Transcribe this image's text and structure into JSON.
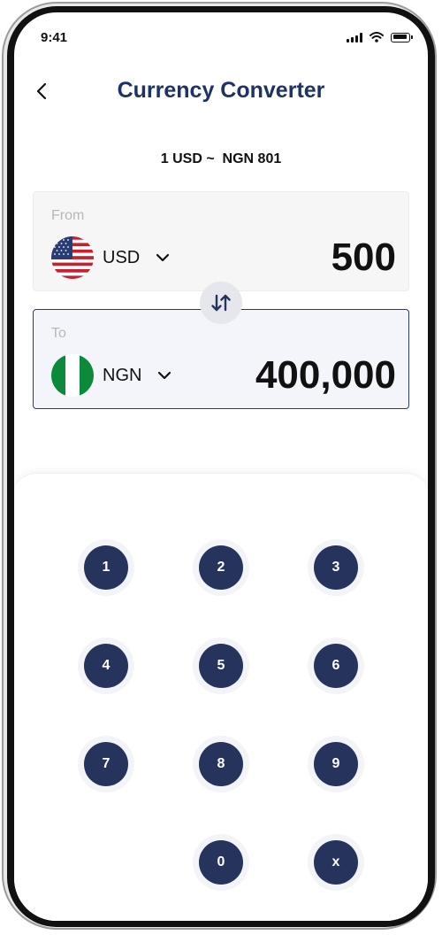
{
  "status_bar": {
    "time": "9:41"
  },
  "header": {
    "title": "Currency Converter"
  },
  "rate": {
    "text": "1 USD ~  NGN 801"
  },
  "from": {
    "label": "From",
    "currency": "USD",
    "amount": "500"
  },
  "to": {
    "label": "To",
    "currency": "NGN",
    "amount": "400,000"
  },
  "keypad": {
    "keys": [
      "1",
      "2",
      "3",
      "4",
      "5",
      "6",
      "7",
      "8",
      "9",
      "0",
      "x"
    ]
  },
  "colors": {
    "title": "#1f3266",
    "key_bg": "#26335c",
    "to_border": "#2a3a6a",
    "nigeria_green": "#0a8a3a"
  },
  "icons": {
    "back": "chevron-left-icon",
    "dropdown": "chevron-down-icon",
    "swap": "swap-vertical-icon",
    "signal": "signal-icon",
    "wifi": "wifi-icon",
    "battery": "battery-icon"
  }
}
